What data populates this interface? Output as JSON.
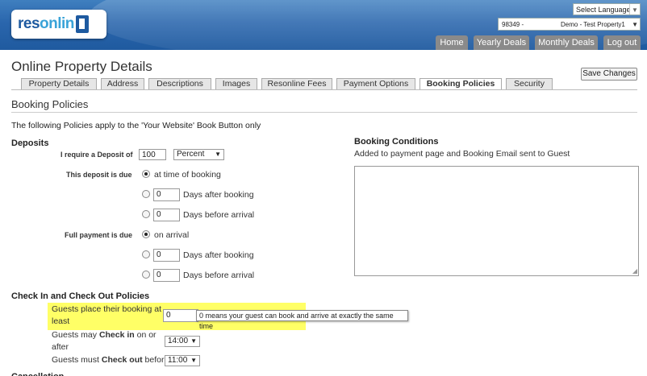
{
  "header": {
    "logo_text": "resonline",
    "language_select": "Select Language",
    "property_select": {
      "code": "98349 -",
      "name": "Demo - Test Property1"
    },
    "nav": [
      "Home",
      "Yearly Deals",
      "Monthly Deals",
      "Log out"
    ]
  },
  "page": {
    "title": "Online Property Details",
    "save_button": "Save Changes",
    "tabs": [
      "Property Details",
      "Address",
      "Descriptions",
      "Images",
      "Resonline Fees",
      "Payment Options",
      "Booking Policies",
      "Security"
    ],
    "active_tab": "Booking Policies",
    "section_title": "Booking Policies",
    "intro": "The following Policies apply to the 'Your Website' Book Button only"
  },
  "deposits": {
    "heading": "Deposits",
    "require_label": "I require a Deposit of",
    "amount": "100",
    "unit": "Percent",
    "due_label": "This deposit is due",
    "due_options": [
      {
        "text": "at time of booking",
        "selected": true
      },
      {
        "value": "0",
        "text": "Days after booking",
        "selected": false
      },
      {
        "value": "0",
        "text": "Days before arrival",
        "selected": false
      }
    ],
    "full_label": "Full payment is due",
    "full_options": [
      {
        "text": "on arrival",
        "selected": true
      },
      {
        "value": "0",
        "text": "Days after booking",
        "selected": false
      },
      {
        "value": "0",
        "text": "Days before arrival",
        "selected": false
      }
    ]
  },
  "conditions": {
    "heading": "Booking Conditions",
    "subtitle": "Added to payment page and Booking Email sent to Guest"
  },
  "checkin": {
    "heading": "Check In and Check Out Policies",
    "place_label_1": "Guests place their booking at",
    "place_label_2": "least",
    "place_value": "0",
    "tooltip": "0 means your guest can book and arrive at exactly the same time",
    "checkin_pre": "Guests may ",
    "checkin_bold": "Check in",
    "checkin_post": " on or",
    "checkin_line2": "after",
    "checkin_time": "14:00",
    "checkout_pre": "Guests must ",
    "checkout_bold": "Check out",
    "checkout_post": " before",
    "checkout_time": "11:00"
  },
  "next_heading": "Cancellation"
}
